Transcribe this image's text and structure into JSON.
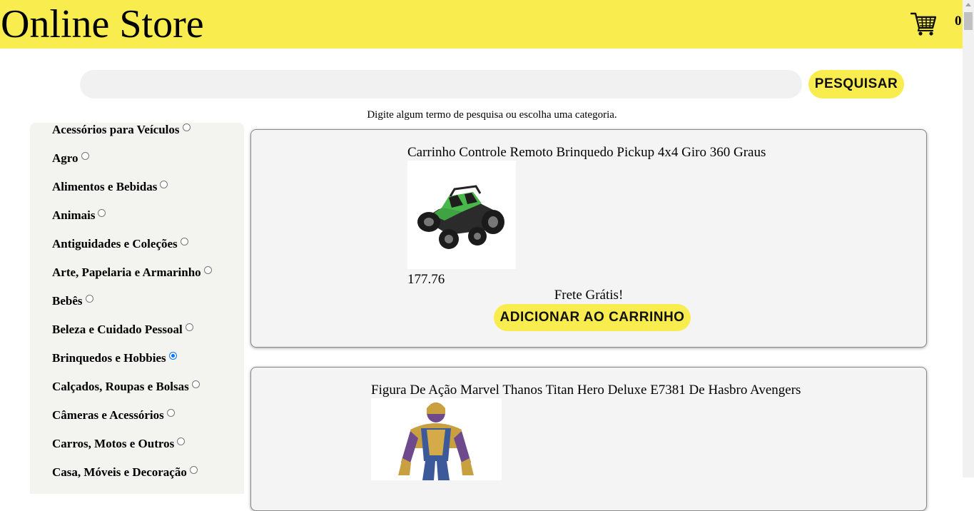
{
  "header": {
    "brand": "Online Store",
    "cart_count": "0",
    "cart_icon": "shopping-cart-icon",
    "background_color": "#f8ec4f"
  },
  "search": {
    "value": "",
    "placeholder": "",
    "button_label": "PESQUISAR",
    "hint": "Digite algum termo de pesquisa ou escolha uma categoria."
  },
  "sidebar": {
    "categories": [
      {
        "label": "Acessórios para Veículos",
        "selected": false
      },
      {
        "label": "Agro",
        "selected": false
      },
      {
        "label": "Alimentos e Bebidas",
        "selected": false
      },
      {
        "label": "Animais",
        "selected": false
      },
      {
        "label": "Antiguidades e Coleções",
        "selected": false
      },
      {
        "label": "Arte, Papelaria e Armarinho",
        "selected": false
      },
      {
        "label": "Bebês",
        "selected": false
      },
      {
        "label": "Beleza e Cuidado Pessoal",
        "selected": false
      },
      {
        "label": "Brinquedos e Hobbies",
        "selected": true
      },
      {
        "label": "Calçados, Roupas e Bolsas",
        "selected": false
      },
      {
        "label": "Câmeras e Acessórios",
        "selected": false
      },
      {
        "label": "Carros, Motos e Outros",
        "selected": false
      },
      {
        "label": "Casa, Móveis e Decoração",
        "selected": false
      }
    ]
  },
  "products": [
    {
      "title": "Carrinho Controle Remoto Brinquedo Pickup 4x4 Giro 360 Graus",
      "price": "177.76",
      "shipping": "Frete Grátis!",
      "add_label": "ADICIONAR AO CARRINHO",
      "image": "rc-pickup-truck-image"
    },
    {
      "title": "Figura De Ação Marvel Thanos Titan Hero Deluxe E7381 De Hasbro Avengers",
      "image": "thanos-action-figure-image"
    }
  ]
}
